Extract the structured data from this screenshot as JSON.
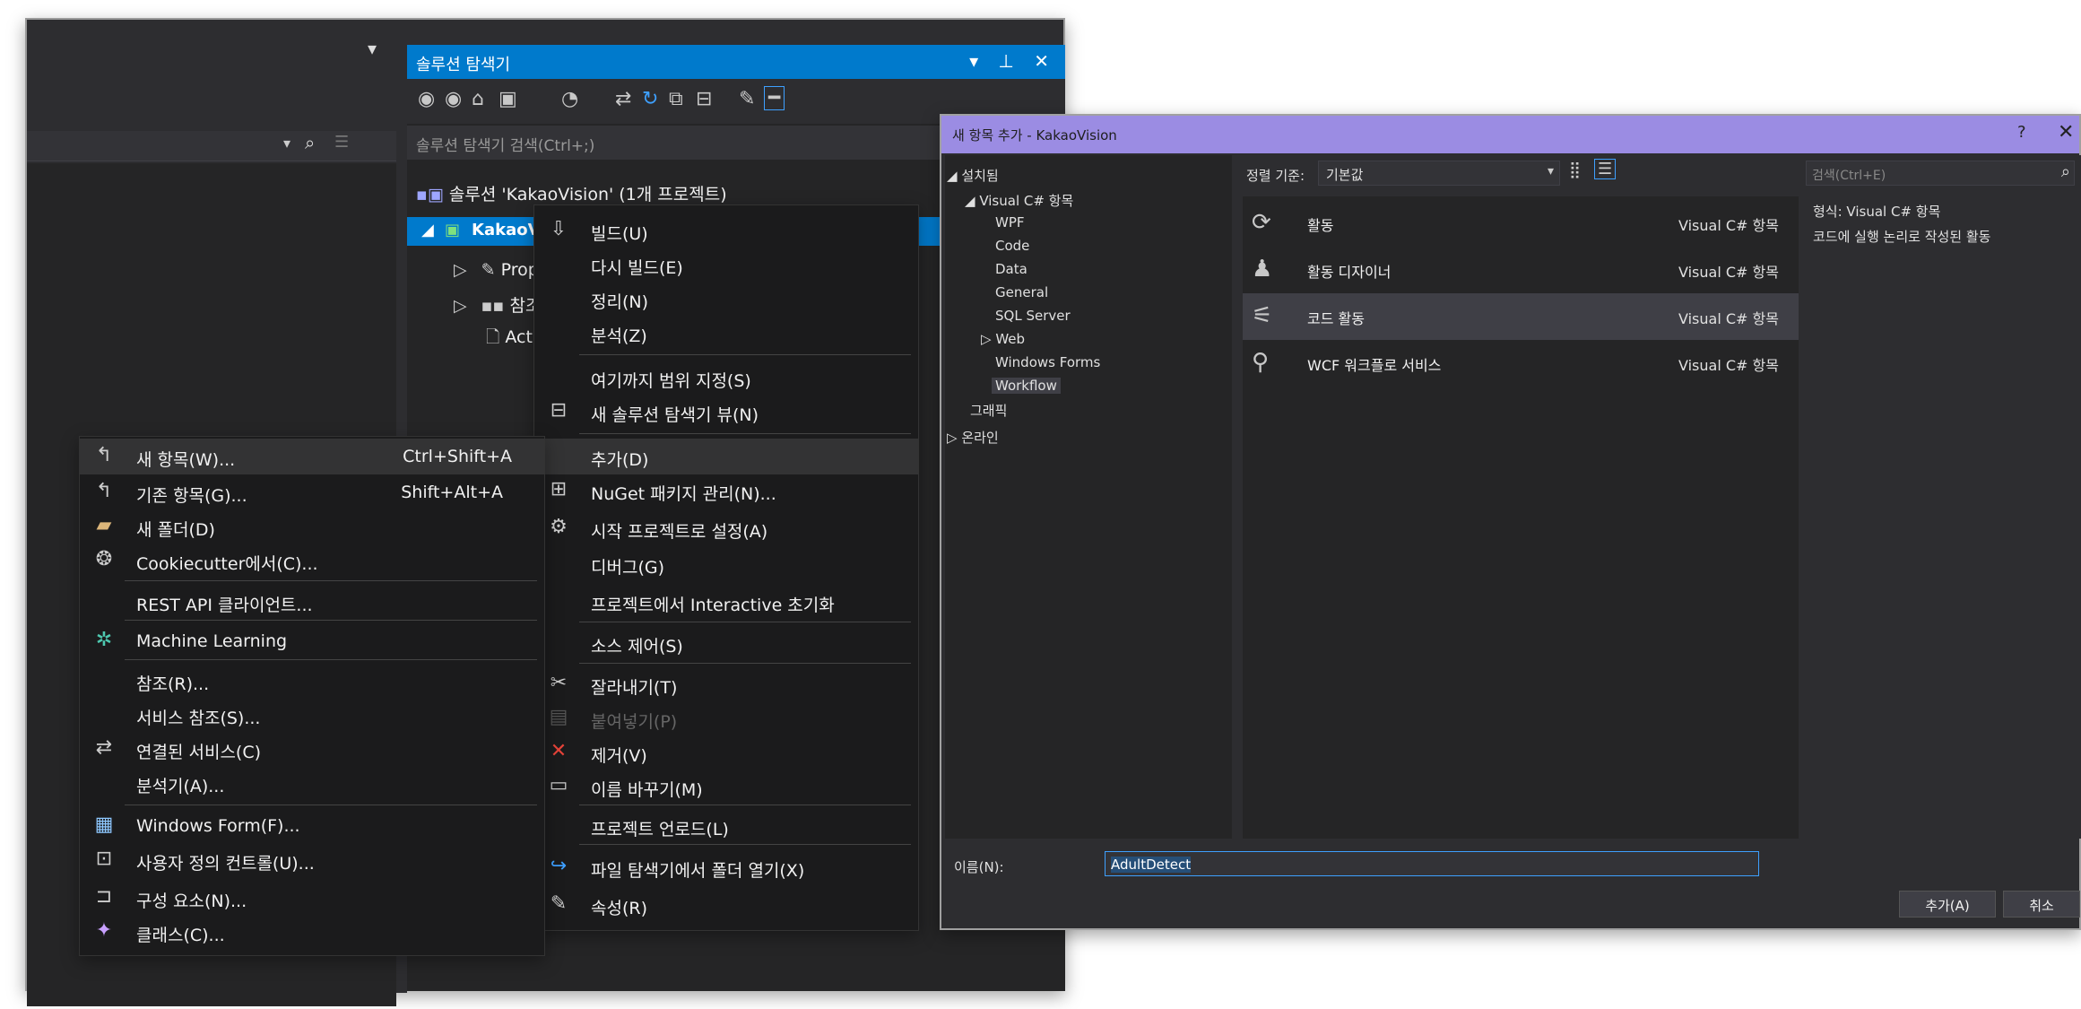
{
  "solution_explorer": {
    "title": "솔루션 탐색기",
    "title_icons": "▾ ⊥ ✕",
    "search_placeholder": "솔루션 탐색기 검색(Ctrl+;)",
    "solution_label": "솔루션 'KakaoVision' (1개 프로젝트)",
    "project_label": "KakaoVision",
    "properties_label": "Prope",
    "references_label": "참조",
    "activity_label": "Activ"
  },
  "context_menu": {
    "items": [
      {
        "label": "빌드(U)",
        "icon": "build-icon"
      },
      {
        "label": "다시 빌드(E)"
      },
      {
        "label": "정리(N)"
      },
      {
        "label": "분석(Z)"
      },
      {
        "label": "여기까지 범위 지정(S)"
      },
      {
        "label": "새 솔루션 탐색기 뷰(N)",
        "icon": "new-view-icon"
      },
      {
        "label": "추가(D)"
      },
      {
        "label": "NuGet 패키지 관리(N)...",
        "icon": "nuget-icon"
      },
      {
        "label": "시작 프로젝트로 설정(A)",
        "icon": "gear-icon"
      },
      {
        "label": "디버그(G)"
      },
      {
        "label": "프로젝트에서 Interactive 초기화"
      },
      {
        "label": "소스 제어(S)"
      },
      {
        "label": "잘라내기(T)",
        "icon": "scissors-icon"
      },
      {
        "label": "붙여넣기(P)",
        "icon": "paste-icon"
      },
      {
        "label": "제거(V)",
        "icon": "remove-icon"
      },
      {
        "label": "이름 바꾸기(M)",
        "icon": "rename-icon"
      },
      {
        "label": "프로젝트 언로드(L)"
      },
      {
        "label": "파일 탐색기에서 폴더 열기(X)",
        "icon": "open-folder-icon"
      },
      {
        "label": "속성(R)",
        "icon": "wrench-icon"
      }
    ]
  },
  "submenu": {
    "items": [
      {
        "label": "새 항목(W)...",
        "shortcut": "Ctrl+Shift+A",
        "icon": "new-item-icon"
      },
      {
        "label": "기존 항목(G)...",
        "shortcut": "Shift+Alt+A",
        "icon": "existing-item-icon"
      },
      {
        "label": "새 폴더(D)",
        "icon": "folder-icon"
      },
      {
        "label": "Cookiecutter에서(C)...",
        "icon": "cookiecutter-icon"
      },
      {
        "label": "REST API 클라이언트..."
      },
      {
        "label": "Machine Learning",
        "icon": "ml-icon"
      },
      {
        "label": "참조(R)..."
      },
      {
        "label": "서비스 참조(S)..."
      },
      {
        "label": "연결된 서비스(C)",
        "icon": "connected-service-icon"
      },
      {
        "label": "분석기(A)..."
      },
      {
        "label": "Windows Form(F)...",
        "icon": "form-icon"
      },
      {
        "label": "사용자 정의 컨트롤(U)...",
        "icon": "user-control-icon"
      },
      {
        "label": "구성 요소(N)...",
        "icon": "component-icon"
      },
      {
        "label": "클래스(C)...",
        "icon": "class-icon"
      }
    ]
  },
  "dialog": {
    "title": "새 항목 추가 - KakaoVision",
    "help": "?",
    "close": "✕",
    "installed": "설치됨",
    "tree": {
      "visual_csharp": "Visual C# 항목",
      "children": [
        "WPF",
        "Code",
        "Data",
        "General",
        "SQL Server",
        "Web",
        "Windows Forms",
        "Workflow"
      ],
      "graphics": "그래픽",
      "online": "온라인"
    },
    "sort_label": "정렬 기준:",
    "sort_value": "기본값",
    "search_placeholder": "검색(Ctrl+E)",
    "templates": [
      {
        "name": "활동",
        "type": "Visual C# 항목",
        "icon": "activity-icon"
      },
      {
        "name": "활동 디자이너",
        "type": "Visual C# 항목",
        "icon": "activity-designer-icon"
      },
      {
        "name": "코드 활동",
        "type": "Visual C# 항목",
        "icon": "code-activity-icon"
      },
      {
        "name": "WCF 워크플로 서비스",
        "type": "Visual C# 항목",
        "icon": "wcf-service-icon"
      }
    ],
    "details_type_label": "형식: Visual C# 항목",
    "details_desc": "코드에 실행 논리로 작성된 활동",
    "name_label": "이름(N):",
    "name_value": "AdultDetect",
    "add_button": "추가(A)",
    "cancel_button": "취소"
  }
}
